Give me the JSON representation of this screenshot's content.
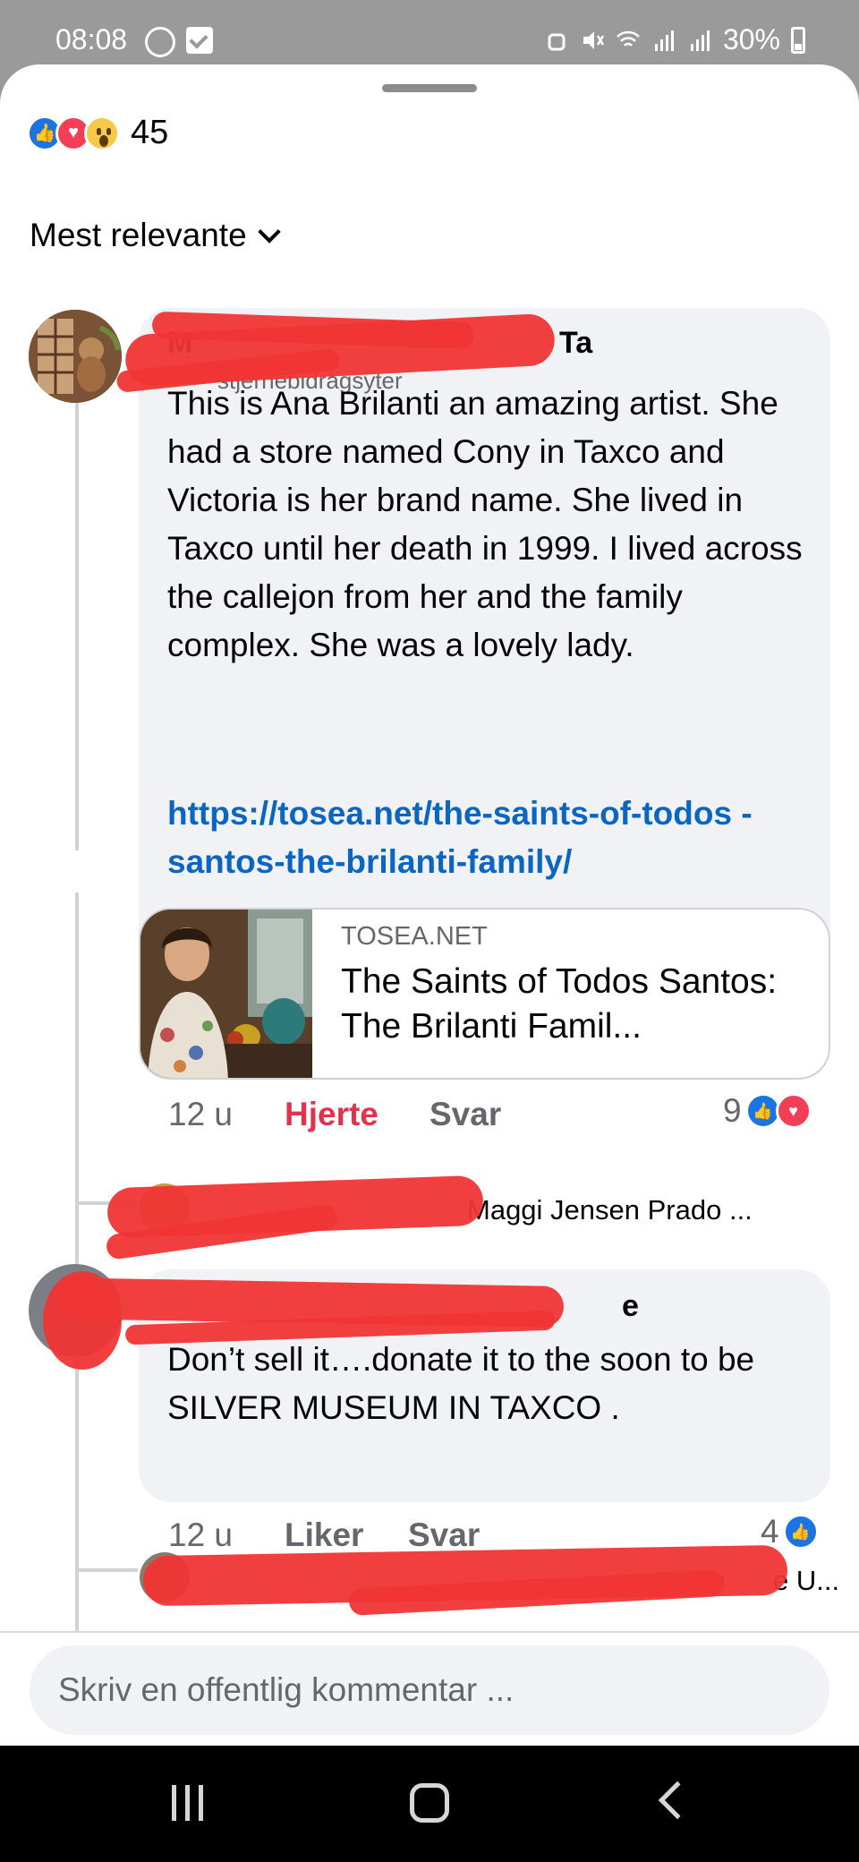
{
  "status_bar": {
    "time": "08:08",
    "battery": "30%",
    "icons": [
      "whatsapp-icon",
      "check-icon",
      "alarm-icon",
      "mute-icon",
      "wifi-icon",
      "signal-icon",
      "signal-icon",
      "battery-icon"
    ]
  },
  "reactions": {
    "types": [
      "like",
      "love",
      "wow"
    ],
    "count": "45"
  },
  "sort": {
    "label": "Mest relevante"
  },
  "comments": [
    {
      "author_partial": "M",
      "author_trailing": "Ta",
      "subtitle_partial": "stjernebidragsyter",
      "text": "This is Ana Brilanti an amazing artist. She had a store named Cony in Taxco and Victoria is her brand name. She lived in Taxco until her death in 1999. I lived across the callejon from her and the family complex. She was a lovely lady.",
      "link": "https://tosea.net/the-saints-of-todos -santos-the-brilanti-family/",
      "preview": {
        "domain": "TOSEA.NET",
        "title": "The Saints of Todos Santos: The Brilanti Famil..."
      },
      "time": "12 u",
      "react_label": "Hjerte",
      "reply_label": "Svar",
      "reaction_count": "9",
      "reaction_types": [
        "like",
        "love"
      ],
      "reply_preview": "Maggi Jensen Prado ..."
    },
    {
      "author_partial": "e",
      "text": "Don’t sell it….donate it to the soon to be SILVER MUSEUM IN TAXCO .",
      "time": "12 u",
      "react_label": "Liker",
      "reply_label": "Svar",
      "reaction_count": "4",
      "reaction_types": [
        "like"
      ],
      "reply_preview": "e U..."
    }
  ],
  "comment_input": {
    "placeholder": "Skriv en offentlig kommentar ..."
  },
  "colors": {
    "like_blue": "#1b74e4",
    "love_red": "#f33e58",
    "link_blue": "#0a66c2",
    "bubble_gray": "#f0f2f5",
    "redaction_red": "#f03535"
  }
}
